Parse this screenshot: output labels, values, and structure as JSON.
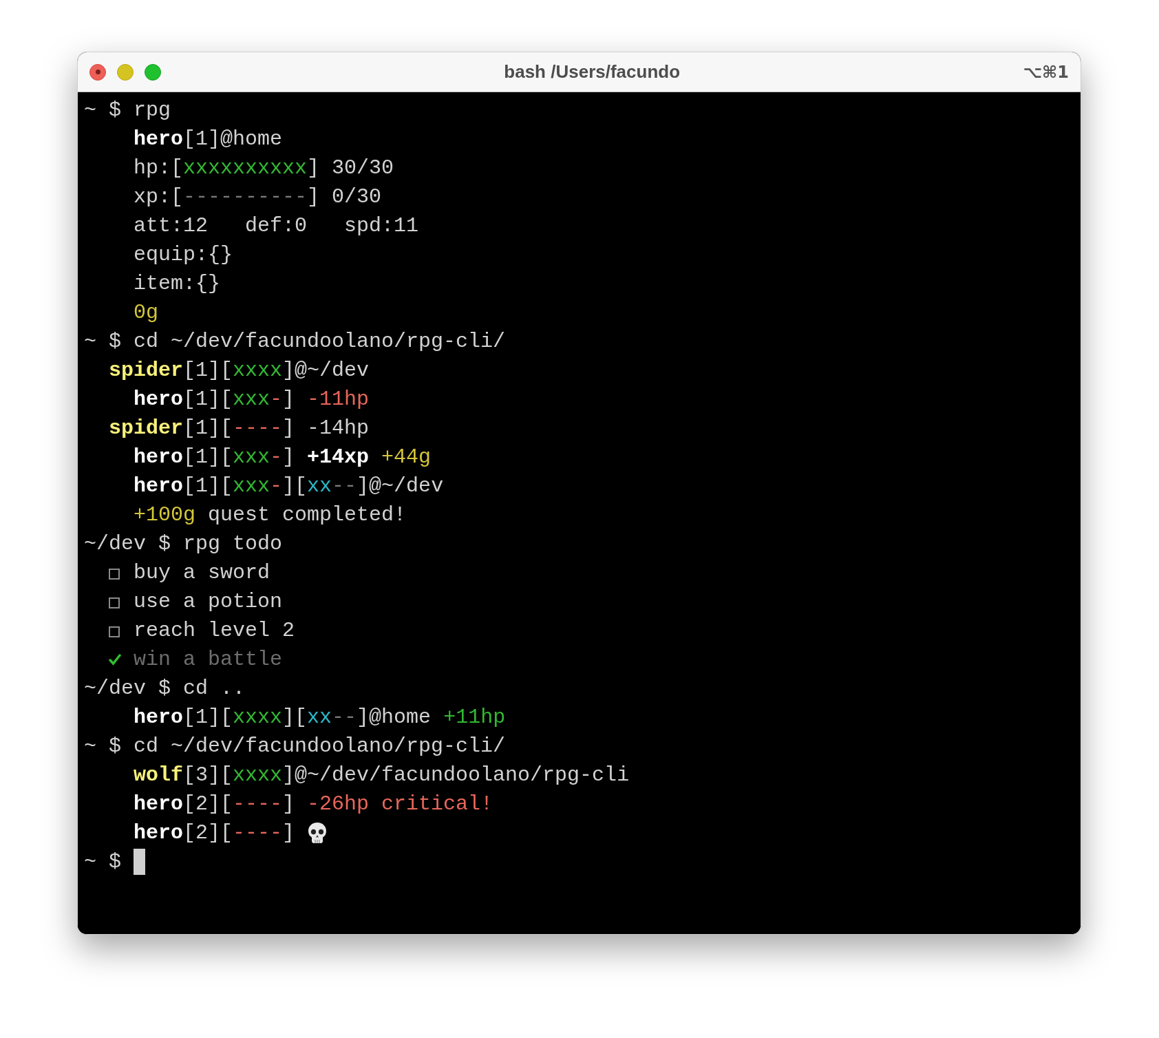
{
  "window": {
    "title": "bash /Users/facundo",
    "shortcut": "⌥⌘1"
  },
  "lines": [
    {
      "kind": "command",
      "segments": [
        {
          "kind": "plain",
          "text": "~ $ rpg"
        }
      ]
    },
    {
      "kind": "deep",
      "segments": [
        {
          "kind": "bold",
          "text": "hero"
        },
        {
          "kind": "plain",
          "text": "[1]@home"
        }
      ]
    },
    {
      "kind": "deep",
      "segments": [
        {
          "kind": "plain",
          "text": "hp:["
        },
        {
          "kind": "green",
          "text": "xxxxxxxxxx"
        },
        {
          "kind": "plain",
          "text": "] 30/30"
        }
      ]
    },
    {
      "kind": "deep",
      "segments": [
        {
          "kind": "plain",
          "text": "xp:["
        },
        {
          "kind": "dim",
          "text": "----------"
        },
        {
          "kind": "plain",
          "text": "] 0/30"
        }
      ]
    },
    {
      "kind": "deep",
      "segments": [
        {
          "kind": "plain",
          "text": "att:12   def:0   spd:11"
        }
      ]
    },
    {
      "kind": "deep",
      "segments": [
        {
          "kind": "plain",
          "text": "equip:{}"
        }
      ]
    },
    {
      "kind": "deep",
      "segments": [
        {
          "kind": "plain",
          "text": "item:{}"
        }
      ]
    },
    {
      "kind": "deep",
      "segments": [
        {
          "kind": "yellow",
          "text": "0g"
        }
      ]
    },
    {
      "kind": "command",
      "segments": [
        {
          "kind": "plain",
          "text": "~ $ cd ~/dev/facundoolano/rpg-cli/"
        }
      ]
    },
    {
      "kind": "shallow",
      "segments": [
        {
          "kind": "enemy",
          "text": "spider"
        },
        {
          "kind": "plain",
          "text": "[1]["
        },
        {
          "kind": "green",
          "text": "xxxx"
        },
        {
          "kind": "plain",
          "text": "]@~/dev"
        }
      ]
    },
    {
      "kind": "deep",
      "segments": [
        {
          "kind": "bold",
          "text": "hero"
        },
        {
          "kind": "plain",
          "text": "[1]["
        },
        {
          "kind": "green",
          "text": "xxx"
        },
        {
          "kind": "red",
          "text": "-"
        },
        {
          "kind": "plain",
          "text": "] "
        },
        {
          "kind": "red",
          "text": "-11hp"
        }
      ]
    },
    {
      "kind": "shallow",
      "segments": [
        {
          "kind": "enemy",
          "text": "spider"
        },
        {
          "kind": "plain",
          "text": "[1]["
        },
        {
          "kind": "red",
          "text": "----"
        },
        {
          "kind": "plain",
          "text": "] -14hp"
        }
      ]
    },
    {
      "kind": "deep",
      "segments": [
        {
          "kind": "bold",
          "text": "hero"
        },
        {
          "kind": "plain",
          "text": "[1]["
        },
        {
          "kind": "green",
          "text": "xxx"
        },
        {
          "kind": "red",
          "text": "-"
        },
        {
          "kind": "plain",
          "text": "] "
        },
        {
          "kind": "bold",
          "text": "+14xp"
        },
        {
          "kind": "yellow",
          "text": " +44g"
        }
      ]
    },
    {
      "kind": "deep",
      "segments": [
        {
          "kind": "bold",
          "text": "hero"
        },
        {
          "kind": "plain",
          "text": "[1]["
        },
        {
          "kind": "green",
          "text": "xxx"
        },
        {
          "kind": "red",
          "text": "-"
        },
        {
          "kind": "plain",
          "text": "]["
        },
        {
          "kind": "cyan",
          "text": "xx"
        },
        {
          "kind": "dim",
          "text": "--"
        },
        {
          "kind": "plain",
          "text": "]@~/dev"
        }
      ]
    },
    {
      "kind": "deep",
      "segments": [
        {
          "kind": "yellow",
          "text": "+100g"
        },
        {
          "kind": "plain",
          "text": " quest completed!"
        }
      ]
    },
    {
      "kind": "command",
      "segments": [
        {
          "kind": "plain",
          "text": "~/dev $ rpg todo"
        }
      ]
    },
    {
      "kind": "todo",
      "checked": false,
      "segments": [
        {
          "kind": "plain",
          "text": "buy a sword"
        }
      ]
    },
    {
      "kind": "todo",
      "checked": false,
      "segments": [
        {
          "kind": "plain",
          "text": "use a potion"
        }
      ]
    },
    {
      "kind": "todo",
      "checked": false,
      "segments": [
        {
          "kind": "plain",
          "text": "reach level 2"
        }
      ]
    },
    {
      "kind": "todo",
      "checked": true,
      "segments": [
        {
          "kind": "plain",
          "text": "win a battle"
        }
      ]
    },
    {
      "kind": "command",
      "segments": [
        {
          "kind": "plain",
          "text": "~/dev $ cd .."
        }
      ]
    },
    {
      "kind": "deep",
      "segments": [
        {
          "kind": "bold",
          "text": "hero"
        },
        {
          "kind": "plain",
          "text": "[1]["
        },
        {
          "kind": "green",
          "text": "xxxx"
        },
        {
          "kind": "plain",
          "text": "]["
        },
        {
          "kind": "cyan",
          "text": "xx"
        },
        {
          "kind": "dim",
          "text": "--"
        },
        {
          "kind": "plain",
          "text": "]@home "
        },
        {
          "kind": "green",
          "text": "+11hp"
        }
      ]
    },
    {
      "kind": "command",
      "segments": [
        {
          "kind": "plain",
          "text": "~ $ cd ~/dev/facundoolano/rpg-cli/"
        }
      ]
    },
    {
      "kind": "deep",
      "segments": [
        {
          "kind": "enemy",
          "text": "wolf"
        },
        {
          "kind": "plain",
          "text": "[3]["
        },
        {
          "kind": "green",
          "text": "xxxx"
        },
        {
          "kind": "plain",
          "text": "]@~/dev/facundoolano/rpg-cli"
        }
      ]
    },
    {
      "kind": "deep",
      "segments": [
        {
          "kind": "bold",
          "text": "hero"
        },
        {
          "kind": "plain",
          "text": "[2]["
        },
        {
          "kind": "red",
          "text": "----"
        },
        {
          "kind": "plain",
          "text": "] "
        },
        {
          "kind": "red",
          "text": "-26hp critical!"
        }
      ]
    },
    {
      "kind": "deep",
      "segments": [
        {
          "kind": "bold",
          "text": "hero"
        },
        {
          "kind": "plain",
          "text": "[2]["
        },
        {
          "kind": "red",
          "text": "----"
        },
        {
          "kind": "plain",
          "text": "]"
        }
      ],
      "skull": true
    },
    {
      "kind": "command",
      "segments": [
        {
          "kind": "plain",
          "text": "~ $"
        }
      ],
      "cursor": true
    }
  ]
}
